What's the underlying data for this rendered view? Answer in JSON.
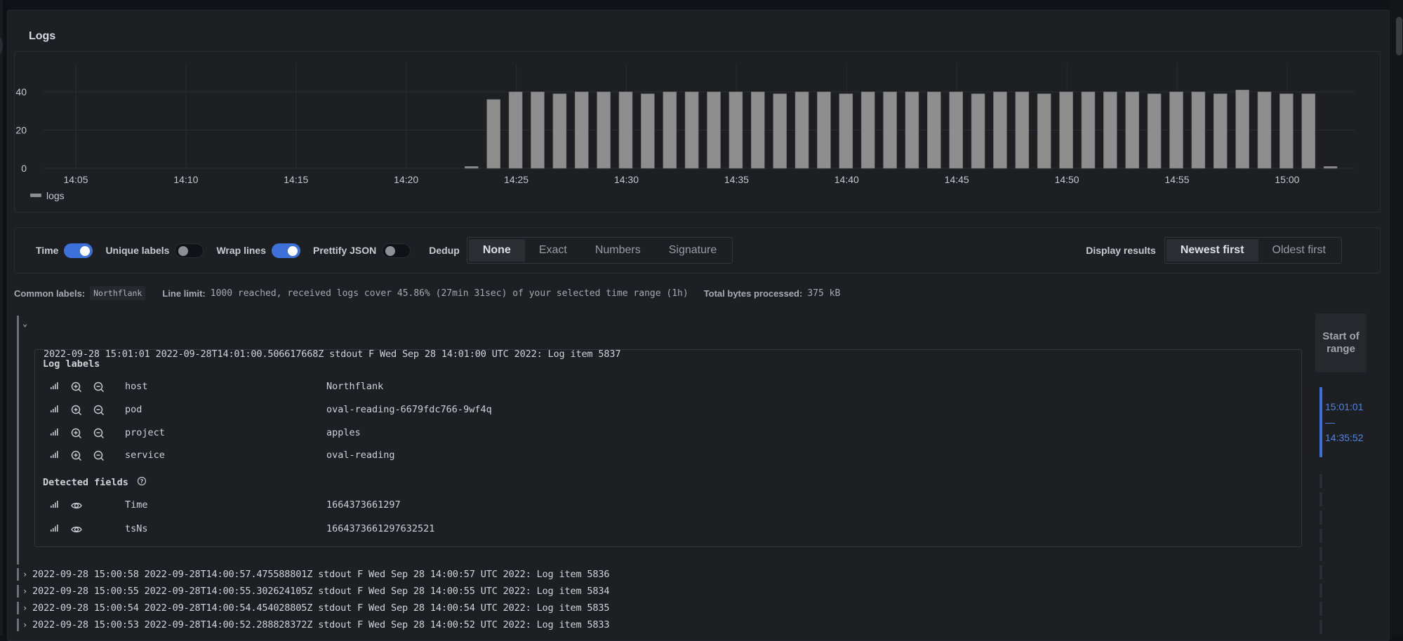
{
  "panel": {
    "title": "Logs"
  },
  "chart_data": {
    "type": "bar",
    "title": "",
    "xlabel": "",
    "ylabel": "",
    "ylim": [
      0,
      45
    ],
    "yticks": [
      0,
      20,
      40
    ],
    "x_range": [
      "14:02",
      "15:03"
    ],
    "xticks": [
      "14:05",
      "14:10",
      "14:15",
      "14:20",
      "14:25",
      "14:30",
      "14:35",
      "14:40",
      "14:45",
      "14:50",
      "14:55",
      "15:00"
    ],
    "grid": true,
    "legend_position": "bottom-left",
    "series": [
      {
        "name": "logs",
        "color": "#8e8e8e",
        "x": [
          "14:23",
          "14:24",
          "14:25",
          "14:26",
          "14:27",
          "14:28",
          "14:29",
          "14:30",
          "14:31",
          "14:32",
          "14:33",
          "14:34",
          "14:35",
          "14:36",
          "14:37",
          "14:38",
          "14:39",
          "14:40",
          "14:41",
          "14:42",
          "14:43",
          "14:44",
          "14:45",
          "14:46",
          "14:47",
          "14:48",
          "14:49",
          "14:50",
          "14:51",
          "14:52",
          "14:53",
          "14:54",
          "14:55",
          "14:56",
          "14:57",
          "14:58",
          "14:59",
          "15:00",
          "15:01",
          "15:02"
        ],
        "values": [
          1,
          36,
          40,
          40,
          39,
          40,
          40,
          40,
          39,
          40,
          40,
          40,
          40,
          40,
          39,
          40,
          40,
          39,
          40,
          40,
          40,
          40,
          40,
          39,
          40,
          40,
          39,
          40,
          40,
          40,
          40,
          39,
          40,
          40,
          39,
          41,
          40,
          39,
          39,
          1
        ]
      }
    ]
  },
  "controls": {
    "toggles": [
      {
        "label": "Time",
        "on": true
      },
      {
        "label": "Unique labels",
        "on": false
      },
      {
        "label": "Wrap lines",
        "on": true
      },
      {
        "label": "Prettify JSON",
        "on": false
      }
    ],
    "dedup": {
      "label": "Dedup",
      "options": [
        "None",
        "Exact",
        "Numbers",
        "Signature"
      ],
      "selected": "None"
    },
    "display": {
      "label": "Display results",
      "options": [
        "Newest first",
        "Oldest first"
      ],
      "selected": "Newest first"
    },
    "accent_color": "#3d71d9"
  },
  "meta": {
    "common_labels_key": "Common labels:",
    "common_labels_value": "Northflank",
    "line_limit_key": "Line limit:",
    "line_limit_value": "1000 reached, received logs cover 45.86% (27min 31sec) of your selected time range (1h)",
    "bytes_key": "Total bytes processed:",
    "bytes_value": "375 kB"
  },
  "logs": {
    "expanded": {
      "text": "2022-09-28 15:01:01 2022-09-28T14:01:00.506617668Z stdout F Wed Sep 28 14:01:00 UTC 2022: Log item 5837",
      "labels_title": "Log labels",
      "labels": [
        {
          "key": "host",
          "value": "Northflank"
        },
        {
          "key": "pod",
          "value": "oval-reading-6679fdc766-9wf4q"
        },
        {
          "key": "project",
          "value": "apples"
        },
        {
          "key": "service",
          "value": "oval-reading"
        }
      ],
      "fields_title": "Detected fields",
      "fields": [
        {
          "key": "Time",
          "value": "1664373661297"
        },
        {
          "key": "tsNs",
          "value": "1664373661297632521"
        }
      ]
    },
    "rows": [
      "2022-09-28 15:00:58 2022-09-28T14:00:57.475588801Z stdout F Wed Sep 28 14:00:57 UTC 2022: Log item 5836",
      "2022-09-28 15:00:55 2022-09-28T14:00:55.302624105Z stdout F Wed Sep 28 14:00:55 UTC 2022: Log item 5834",
      "2022-09-28 15:00:54 2022-09-28T14:00:54.454028805Z stdout F Wed Sep 28 14:00:54 UTC 2022: Log item 5835",
      "2022-09-28 15:00:53 2022-09-28T14:00:52.288828372Z stdout F Wed Sep 28 14:00:52 UTC 2022: Log item 5833"
    ]
  },
  "navigator": {
    "start_button": "Start of range",
    "range_from": "15:01:01",
    "range_sep": "—",
    "range_to": "14:35:52"
  }
}
